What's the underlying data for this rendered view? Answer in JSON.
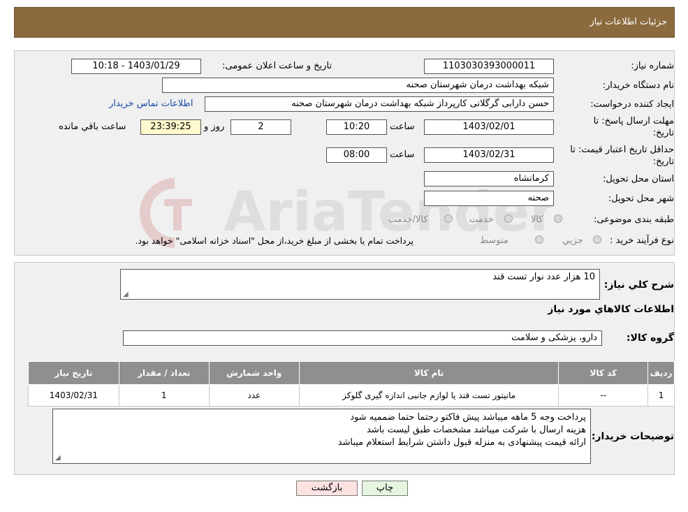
{
  "header": {
    "title": "جزئیات اطلاعات نیاز"
  },
  "form": {
    "need_number_label": "شماره نیاز:",
    "need_number": "1103030393000011",
    "announce_label": "تاریخ و ساعت اعلان عمومی:",
    "announce_value": "1403/01/29 - 10:18",
    "buyer_org_label": "نام دستگاه خریدار:",
    "buyer_org": "شبکه بهداشت درمان شهرستان صحنه",
    "creator_label": "ایجاد کننده درخواست:",
    "creator": "حسن دارابی گرگلانی کارپرداز شبکه بهداشت درمان شهرستان صحنه",
    "contact_link": "اطلاعات تماس خریدار",
    "reply_deadline_label_1": "مهلت ارسال پاسخ: تا",
    "reply_deadline_label_2": "تاریخ:",
    "reply_date": "1403/02/01",
    "time_label": "ساعت",
    "reply_time": "10:20",
    "days_value": "2",
    "days_label": "روز و",
    "remaining_time": "23:39:25",
    "remaining_label": "ساعت باقي مانده",
    "min_validity_label_1": "حداقل تاریخ اعتبار قیمت: تا",
    "min_validity_label_2": "تاریخ:",
    "validity_date": "1403/02/31",
    "validity_time": "08:00",
    "province_label": "استان محل تحویل:",
    "province": "کرمانشاه",
    "city_label": "شهر محل تحویل:",
    "city": "صحنه",
    "category_label": "طبقه بندی موضوعی:",
    "category_options": [
      "کالا",
      "خدمت",
      "کالا/خدمت"
    ],
    "process_label": "نوع فرآیند خرید :",
    "process_options": [
      "جزیي",
      "متوسط"
    ],
    "process_note": "پرداخت تمام یا بخشی از مبلغ خرید،از محل \"اسناد خزانه اسلامی\" خواهد بود."
  },
  "summary": {
    "label": "شرح کلي نیاز:",
    "value": "10 هزار عدد نوار تست قند"
  },
  "goods_info_title": "اطلاعات کالاهاي مورد نیاز",
  "goods_group": {
    "label": "گروه کالا:",
    "value": "دارو، پزشکی و سلامت"
  },
  "table": {
    "headers": [
      "ردیف",
      "کد کالا",
      "نام کالا",
      "واحد شمارش",
      "تعداد / مقدار",
      "تاریخ نیاز"
    ],
    "rows": [
      [
        "1",
        "--",
        "مانیتور تست قند یا لوازم جانبی اندازه گیری گلوکز",
        "عدد",
        "1",
        "1403/02/31"
      ]
    ]
  },
  "buyer_notes": {
    "label": "توضیحات خریدار:",
    "lines": [
      "پرداخت وجه 5 ماهه میباشد پیش فاکتو رحتما حتما ضممیه شود",
      "هزینه ارسال با شرکت میباشد مشخصات طبق لیست باشد",
      "ارائه قیمت پیشنهادی به منزله قبول داشتن شرایط استعلام میباشد"
    ]
  },
  "buttons": {
    "print": "چاپ",
    "back": "بازگشت"
  },
  "watermark": {
    "text": "AriaTender.neT"
  },
  "colors": {
    "header_bg": "#8b6a3e",
    "table_header_bg": "#8f8f8f",
    "time_bg": "#fffacd",
    "back_btn_bg": "#fde2e2",
    "print_btn_bg": "#e6f5e0",
    "link": "#1a4ba8"
  }
}
